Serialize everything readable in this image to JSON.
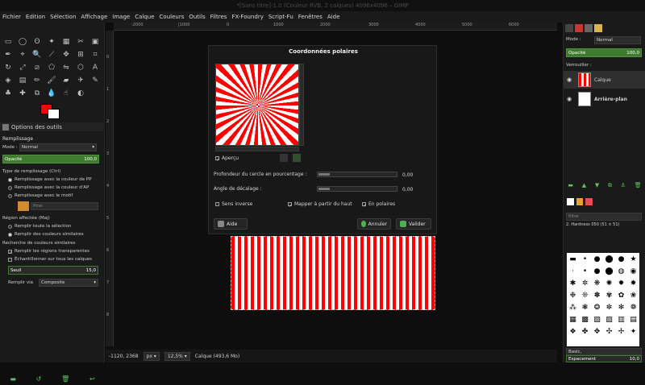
{
  "window": {
    "title": "*[Sans titre]-1.0 (Couleur RVB, 2 calques) 4096x4096 – GIMP"
  },
  "menu": [
    "Fichier",
    "Edition",
    "Sélection",
    "Affichage",
    "Image",
    "Calque",
    "Couleurs",
    "Outils",
    "Filtres",
    "FX-Foundry",
    "Script-Fu",
    "Fenêtres",
    "Aide"
  ],
  "tool_options": {
    "tab_label": "Options des outils",
    "title": "Remplissage",
    "mode_label": "Mode :",
    "mode_value": "Normal",
    "opacity_label": "Opacité",
    "opacity_value": "100,0",
    "fill_type_label": "Type de remplissage (Ctrl)",
    "fill_options": [
      "Remplissage avec la couleur de PP",
      "Remplissage avec la couleur d'AP",
      "Remplissage avec le motif"
    ],
    "pattern_name": "Pine",
    "area_label": "Région affectée (Maj)",
    "area_options": [
      "Remplir toute la sélection",
      "Remplir des couleurs similaires"
    ],
    "similar_label": "Recherche de couleurs similaires",
    "check_transparent": "Remplir les régions transparentes",
    "check_sample": "Échantillonner sur tous les calques",
    "threshold_label": "Seuil",
    "threshold_value": "15,0",
    "fillby_label": "Remplir via",
    "fillby_value": "Composite"
  },
  "rulers": {
    "h": [
      "-2000",
      "|1000",
      "0",
      "1000",
      "2000",
      "3000",
      "4000",
      "5000",
      "6000"
    ],
    "v": [
      "0",
      "1",
      "2",
      "3",
      "4",
      "5",
      "6",
      "7",
      "8"
    ]
  },
  "status": {
    "coords": "-1120, 2368",
    "unit": "px",
    "zoom": "12,5%",
    "layer": "Calque (493,6 Mo)"
  },
  "dialog": {
    "title": "Coordonnées polaires",
    "preview_label": "Aperçu",
    "depth_label": "Profondeur du cercle en pourcentage :",
    "depth_value": "0,00",
    "angle_label": "Angle de décalage :",
    "angle_value": "0,00",
    "check_inverse": "Sens inverse",
    "check_top": "Mapper à partir du haut",
    "check_polar": "En polaires",
    "help_button": "Aide",
    "cancel_button": "Annuler",
    "ok_button": "Valider"
  },
  "layers": {
    "mode_label": "Mode :",
    "mode_value": "Normal",
    "opacity_label": "Opacité",
    "opacity_value": "100,0",
    "lock_label": "Verrouiller :",
    "items": [
      {
        "name": "Calque"
      },
      {
        "name": "Arrière-plan"
      }
    ]
  },
  "brushes": {
    "filter_value": "filtre",
    "brush_name": "2. Hardness 050 (51 × 51)",
    "preset_value": "Basic,",
    "spacing_label": "Espacement",
    "spacing_value": "10,0"
  }
}
